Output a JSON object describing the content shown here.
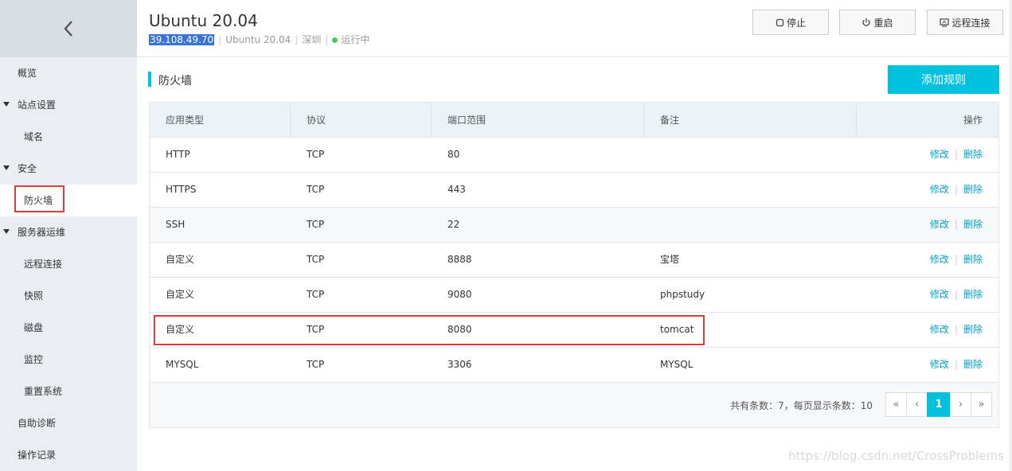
{
  "sidebar": {
    "items": [
      {
        "label": "概览"
      },
      {
        "label": "站点设置"
      },
      {
        "label": "域名"
      },
      {
        "label": "安全"
      },
      {
        "label": "防火墙"
      },
      {
        "label": "服务器运维"
      },
      {
        "label": "远程连接"
      },
      {
        "label": "快照"
      },
      {
        "label": "磁盘"
      },
      {
        "label": "监控"
      },
      {
        "label": "重置系统"
      },
      {
        "label": "自助诊断"
      },
      {
        "label": "操作记录"
      }
    ]
  },
  "header": {
    "title": "Ubuntu 20.04",
    "ip": "39.108.49.70",
    "os": "Ubuntu 20.04",
    "region": "深圳",
    "status": "运行中",
    "status_color": "#4cc764",
    "buttons": {
      "stop": "停止",
      "restart": "重启",
      "remote": "远程连接"
    }
  },
  "section": {
    "title": "防火墙",
    "add_button": "添加规则"
  },
  "table": {
    "columns": [
      "应用类型",
      "协议",
      "端口范围",
      "备注",
      "操作"
    ],
    "rows": [
      {
        "type": "HTTP",
        "protocol": "TCP",
        "port": "80",
        "note": ""
      },
      {
        "type": "HTTPS",
        "protocol": "TCP",
        "port": "443",
        "note": ""
      },
      {
        "type": "SSH",
        "protocol": "TCP",
        "port": "22",
        "note": ""
      },
      {
        "type": "自定义",
        "protocol": "TCP",
        "port": "8888",
        "note": "宝塔"
      },
      {
        "type": "自定义",
        "protocol": "TCP",
        "port": "9080",
        "note": "phpstudy"
      },
      {
        "type": "自定义",
        "protocol": "TCP",
        "port": "8080",
        "note": "tomcat"
      },
      {
        "type": "MYSQL",
        "protocol": "TCP",
        "port": "3306",
        "note": "MYSQL"
      }
    ],
    "actions": {
      "edit": "修改",
      "delete": "删除"
    }
  },
  "pagination": {
    "summary": "共有条数：7，每页显示条数：10",
    "first": "«",
    "prev": "‹",
    "current": "1",
    "next": "›",
    "last": "»"
  },
  "watermark": "https://blog.csdn.net/CrossProblems",
  "colors": {
    "accent": "#00c1de",
    "link": "#00a2ca",
    "highlight": "#e0393e"
  }
}
